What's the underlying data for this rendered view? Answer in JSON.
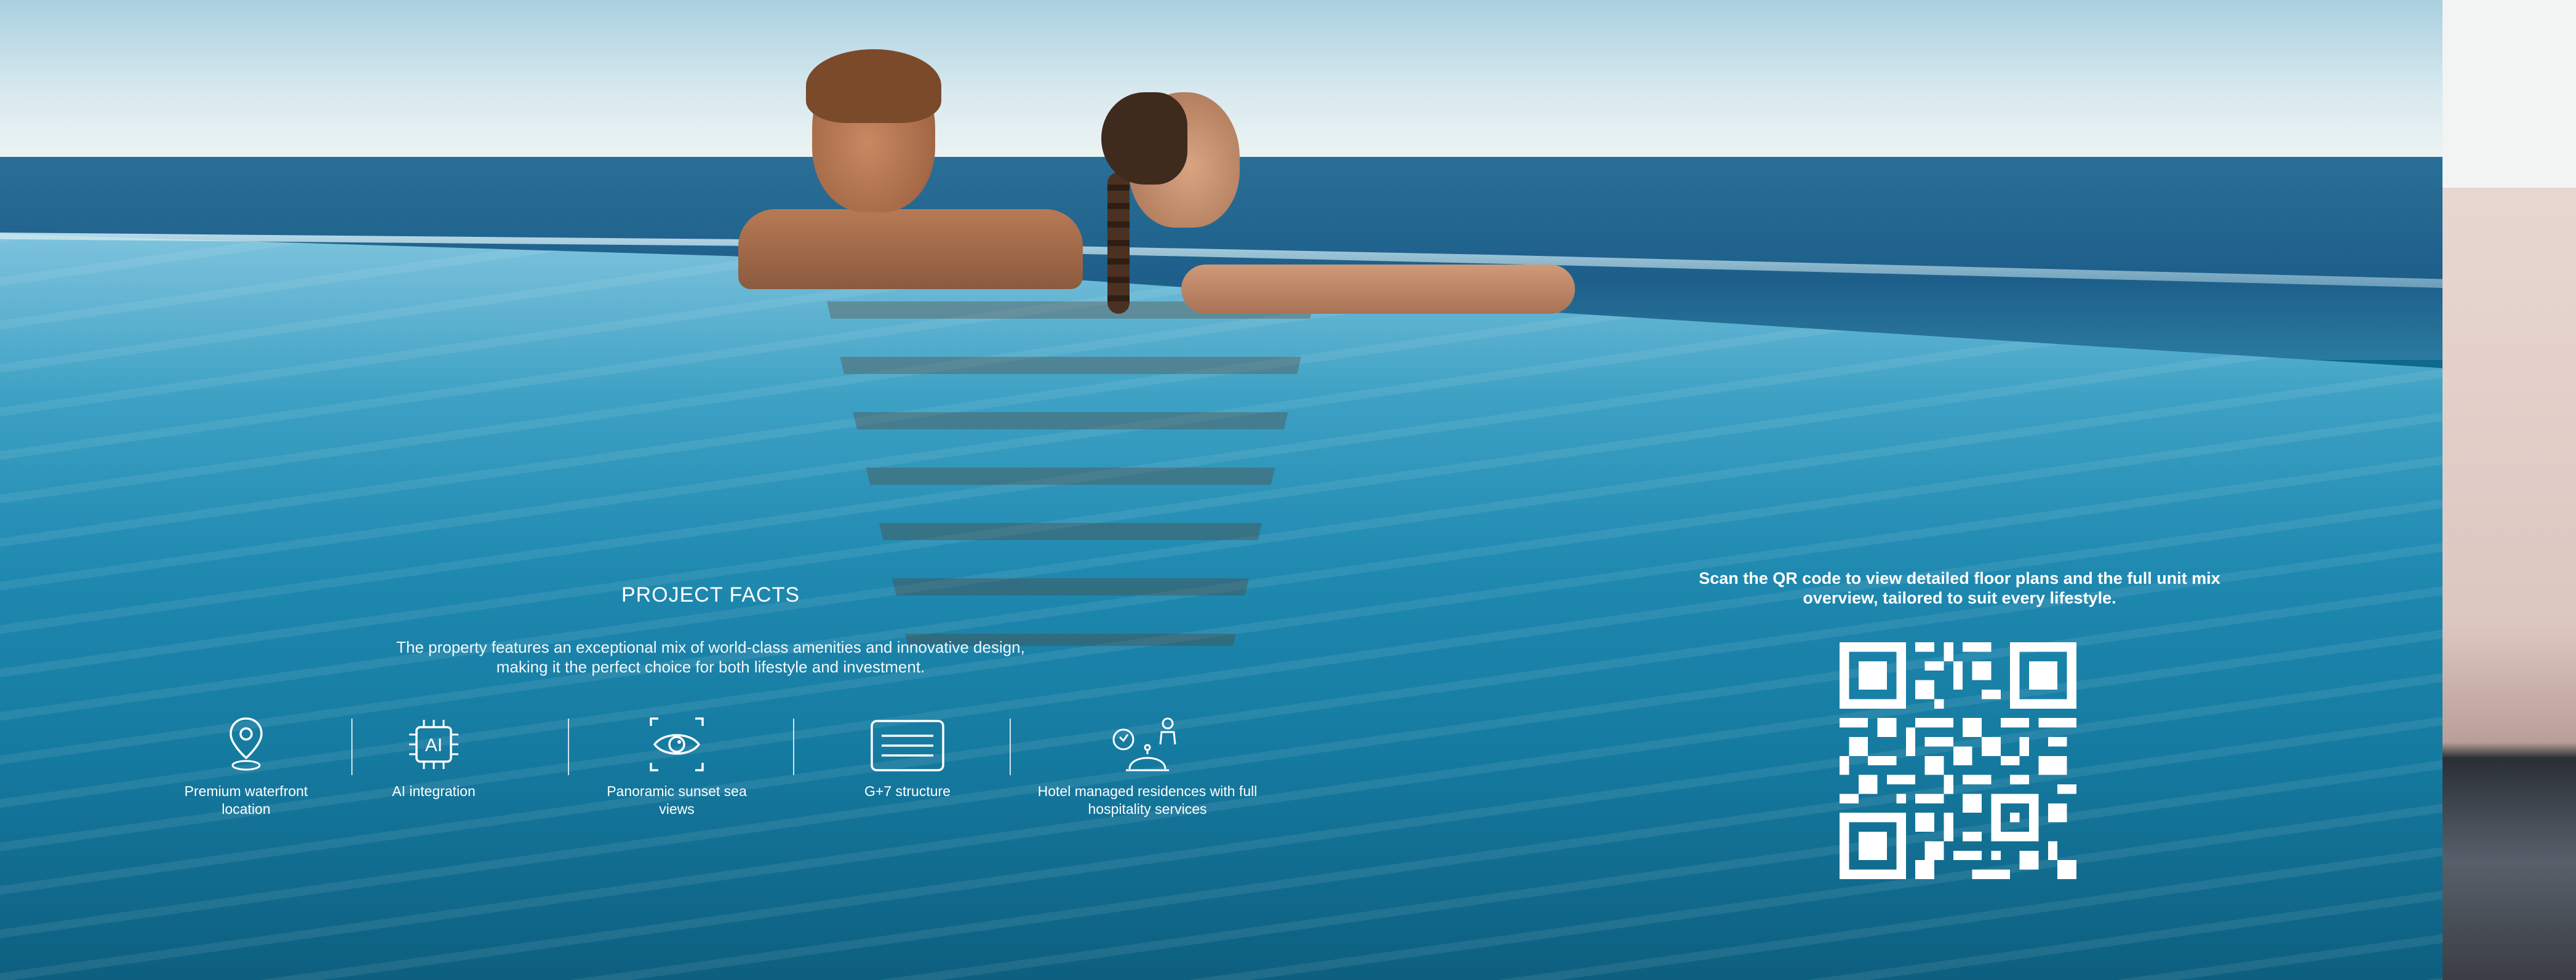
{
  "project_facts": {
    "title": "PROJECT FACTS",
    "description": "The property features an exceptional mix of world-class amenities and innovative design, making it the perfect choice for both lifestyle and investment."
  },
  "features": [
    {
      "icon": "location-pin-icon",
      "label": "Premium waterfront location"
    },
    {
      "icon": "ai-chip-icon",
      "label": "AI integration"
    },
    {
      "icon": "eye-icon",
      "label": "Panoramic sunset sea views"
    },
    {
      "icon": "building-structure-icon",
      "label": "G+7 structure"
    },
    {
      "icon": "hotel-service-bell-icon",
      "label": "Hotel managed residences with full hospitality services"
    }
  ],
  "qr": {
    "caption": "Scan the QR code to view detailed floor plans and the full unit mix overview, tailored to suit every lifestyle.",
    "icon": "qr-code-icon"
  },
  "colors": {
    "text": "#ffffff",
    "pool": "#1f89b0"
  }
}
